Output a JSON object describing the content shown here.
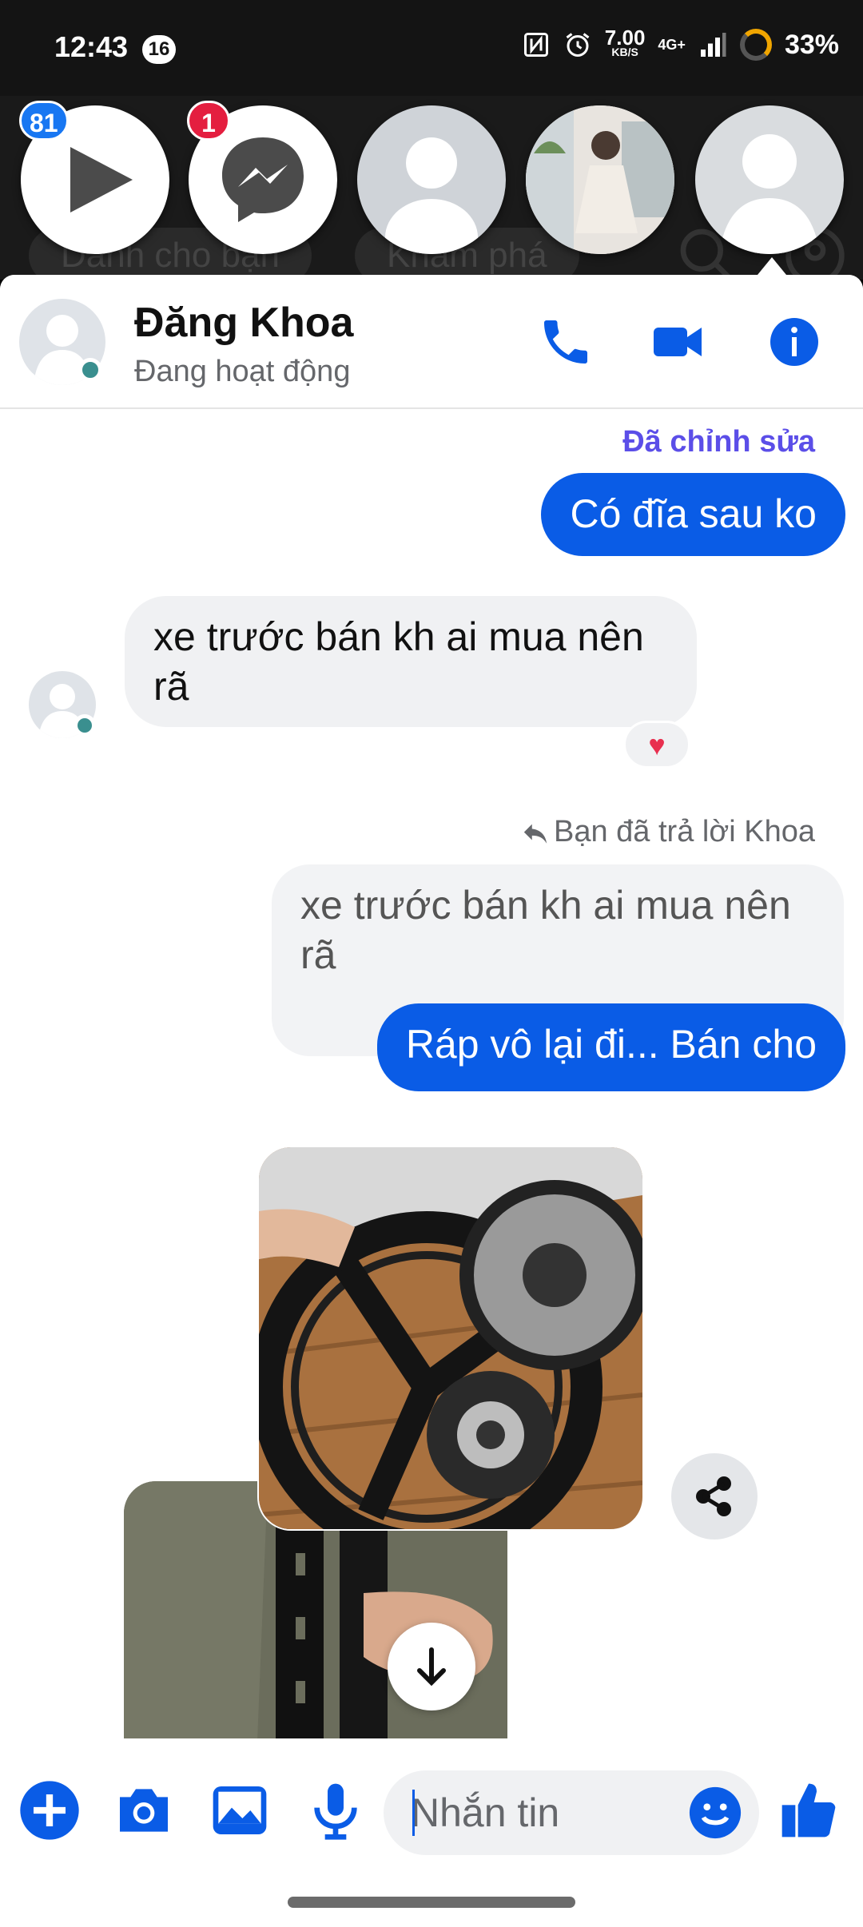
{
  "status_bar": {
    "time": "12:43",
    "notification_count": "16",
    "net_speed_value": "7.00",
    "net_speed_unit": "KB/S",
    "network": "4G+",
    "battery": "33%"
  },
  "background_app": {
    "tab1": "Dành cho bạn",
    "tab2": "Khám phá"
  },
  "chat_heads": [
    {
      "name": "video-app",
      "badge": "81",
      "badge_color": "#1877f2"
    },
    {
      "name": "messenger",
      "badge": "1",
      "badge_color": "#e41e3f"
    },
    {
      "name": "contact-placeholder",
      "badge": ""
    },
    {
      "name": "contact-photo",
      "badge": ""
    },
    {
      "name": "contact-active",
      "badge": ""
    }
  ],
  "contact": {
    "name": "Đăng Khoa",
    "status": "Đang hoạt động"
  },
  "messages": {
    "edited_label": "Đã chỉnh sửa",
    "m1": "Có đĩa sau ko",
    "m2": "xe trước bán kh ai mua nên rã",
    "reply_label": "Bạn đã trả lời Khoa",
    "quoted": "xe trước bán kh ai mua nên rã",
    "m3": "Ráp vô lại đi... Bán cho"
  },
  "composer": {
    "placeholder": "Nhắn tin"
  },
  "colors": {
    "accent": "#0a5ce6",
    "edited": "#5b4ee8",
    "online": "#3a8f8f"
  }
}
